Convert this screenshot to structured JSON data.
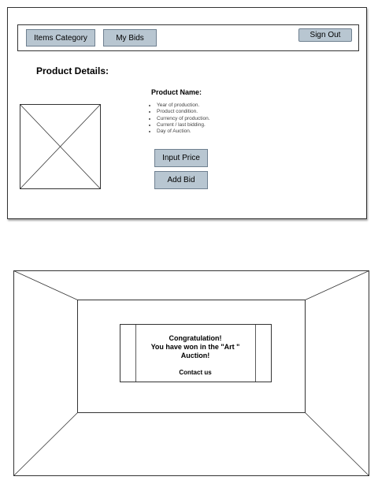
{
  "navbar": {
    "items_category_label": "Items Category",
    "my_bids_label": "My Bids",
    "sign_out_label": "Sign Out"
  },
  "product": {
    "section_title": "Product Details:",
    "name_label": "Product Name:",
    "details": [
      "Year of production.",
      "Product condition.",
      "Currency of production.",
      "Current / last bidding.",
      "Day of Auction."
    ],
    "input_price_label": "Input Price",
    "add_bid_label": "Add Bid"
  },
  "message": {
    "line1": "Congratulation!",
    "line2": "You have won in the \"Art \"",
    "line3": "Auction!",
    "contact_label": "Contact us"
  },
  "colors": {
    "button_fill": "#b8c6d1",
    "button_border": "#6f8090",
    "outline": "#333333"
  }
}
